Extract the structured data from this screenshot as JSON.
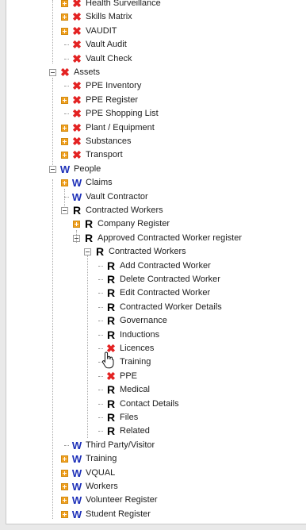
{
  "tree": [
    {
      "level": 1,
      "type": "x",
      "toggle": "plus",
      "label": "Health Surveillance"
    },
    {
      "level": 1,
      "type": "x",
      "toggle": "plus",
      "label": "Skills Matrix"
    },
    {
      "level": 1,
      "type": "x",
      "toggle": "plus",
      "label": "VAUDIT"
    },
    {
      "level": 1,
      "type": "x",
      "toggle": "none",
      "label": "Vault Audit"
    },
    {
      "level": 1,
      "type": "x",
      "toggle": "none",
      "label": "Vault Check"
    },
    {
      "level": 0,
      "type": "x",
      "toggle": "minus",
      "label": "Assets"
    },
    {
      "level": 1,
      "type": "x",
      "toggle": "none",
      "label": "PPE Inventory"
    },
    {
      "level": 1,
      "type": "x",
      "toggle": "plus",
      "label": "PPE Register"
    },
    {
      "level": 1,
      "type": "x",
      "toggle": "none",
      "label": "PPE Shopping List"
    },
    {
      "level": 1,
      "type": "x",
      "toggle": "plus",
      "label": "Plant / Equipment"
    },
    {
      "level": 1,
      "type": "x",
      "toggle": "plus",
      "label": "Substances"
    },
    {
      "level": 1,
      "type": "x",
      "toggle": "plus",
      "label": "Transport"
    },
    {
      "level": 0,
      "type": "w",
      "toggle": "minus",
      "label": "People"
    },
    {
      "level": 1,
      "type": "w",
      "toggle": "plus",
      "label": "Claims"
    },
    {
      "level": 1,
      "type": "w",
      "toggle": "none",
      "label": "Vault Contractor"
    },
    {
      "level": 1,
      "type": "r",
      "toggle": "minus",
      "label": "Contracted Workers"
    },
    {
      "level": 2,
      "type": "r",
      "toggle": "plus",
      "label": "Company Register"
    },
    {
      "level": 2,
      "type": "r",
      "toggle": "minus",
      "label": "Approved Contracted Worker register"
    },
    {
      "level": 3,
      "type": "r",
      "toggle": "minus",
      "label": "Contracted Workers"
    },
    {
      "level": 4,
      "type": "r",
      "toggle": "none",
      "label": "Add Contracted Worker"
    },
    {
      "level": 4,
      "type": "r",
      "toggle": "none",
      "label": "Delete Contracted Worker"
    },
    {
      "level": 4,
      "type": "r",
      "toggle": "none",
      "label": "Edit Contracted Worker"
    },
    {
      "level": 4,
      "type": "r",
      "toggle": "none",
      "label": "Contracted Worker Details"
    },
    {
      "level": 4,
      "type": "r",
      "toggle": "none",
      "label": "Governance"
    },
    {
      "level": 4,
      "type": "r",
      "toggle": "none",
      "label": "Inductions"
    },
    {
      "level": 4,
      "type": "x",
      "toggle": "none",
      "label": "Licences"
    },
    {
      "level": 4,
      "type": "none",
      "toggle": "none",
      "label": "Training"
    },
    {
      "level": 4,
      "type": "x",
      "toggle": "none",
      "label": "PPE"
    },
    {
      "level": 4,
      "type": "r",
      "toggle": "none",
      "label": "Medical"
    },
    {
      "level": 4,
      "type": "r",
      "toggle": "none",
      "label": "Contact Details"
    },
    {
      "level": 4,
      "type": "r",
      "toggle": "none",
      "label": "Files"
    },
    {
      "level": 4,
      "type": "r",
      "toggle": "none",
      "label": "Related"
    },
    {
      "level": 1,
      "type": "w",
      "toggle": "none",
      "label": "Third Party/Visitor"
    },
    {
      "level": 1,
      "type": "w",
      "toggle": "plus",
      "label": "Training"
    },
    {
      "level": 1,
      "type": "w",
      "toggle": "plus",
      "label": "VQUAL"
    },
    {
      "level": 1,
      "type": "w",
      "toggle": "plus",
      "label": "Workers"
    },
    {
      "level": 1,
      "type": "w",
      "toggle": "plus",
      "label": "Volunteer Register"
    },
    {
      "level": 1,
      "type": "w",
      "toggle": "plus",
      "label": "Student Register"
    }
  ],
  "icon_glyphs": {
    "x": "✖",
    "w": "W",
    "r": "R"
  },
  "colors": {
    "x_icon": "#e32222",
    "w_icon": "#1c2fb8",
    "r_icon": "#000000",
    "toggle_plus": "#f0a020"
  }
}
